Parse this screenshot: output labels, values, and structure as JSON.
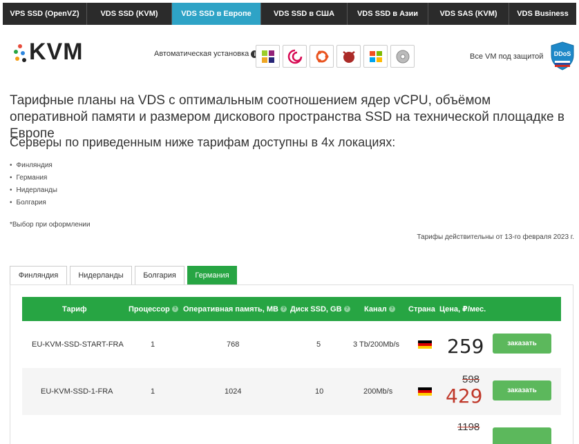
{
  "topnav": {
    "tabs": [
      {
        "label": "VPS SSD (OpenVZ)",
        "active": false
      },
      {
        "label": "VDS SSD (KVM)",
        "active": false
      },
      {
        "label": "VDS SSD в Европе",
        "active": true
      },
      {
        "label": "VDS SSD в США",
        "active": false
      },
      {
        "label": "VDS SSD в Азии",
        "active": false
      },
      {
        "label": "VDS SAS (KVM)",
        "active": false
      },
      {
        "label": "VDS Business",
        "active": false
      }
    ]
  },
  "header": {
    "logo_text": "KVM",
    "auto_install_label": "Автоматическая установка",
    "os_icons": [
      "centos-icon",
      "debian-icon",
      "ubuntu-icon",
      "freebsd-icon",
      "windows-icon",
      "iso-disk-icon"
    ],
    "protection_label": "Все VM под защитой",
    "ddos_badge": "DDoS"
  },
  "content": {
    "headline": "Тарифные планы на VDS с оптимальным соотношением ядер vCPU, объёмом оперативной памяти и размером дискового пространства SSD на технической площадке в Европе",
    "subhead": "Серверы по приведенным ниже тарифам доступны в 4х локациях:",
    "locations": [
      "Финляндия",
      "Германия",
      "Нидерланды",
      "Болгария"
    ],
    "choice_note": "*Выбор при оформлении",
    "valid_note": "Тарифы действительны от 13-го февраля 2023 г."
  },
  "location_tabs": [
    {
      "label": "Финляндия",
      "active": false
    },
    {
      "label": "Нидерланды",
      "active": false
    },
    {
      "label": "Болгария",
      "active": false
    },
    {
      "label": "Германия",
      "active": true
    }
  ],
  "table": {
    "headers": {
      "plan": "Тариф",
      "cpu": "Процессор",
      "ram": "Оперативная память, MB",
      "disk": "Диск SSD, GB",
      "channel": "Канал",
      "country": "Страна",
      "price": "Цена, ₽/мес."
    },
    "rows": [
      {
        "plan": "EU-KVM-SSD-START-FRA",
        "cpu": "1",
        "ram": "768",
        "disk": "5",
        "channel": "3 Tb/200Mb/s",
        "old_price": "",
        "price": "259",
        "order": "заказать"
      },
      {
        "plan": "EU-KVM-SSD-1-FRA",
        "cpu": "1",
        "ram": "1024",
        "disk": "10",
        "channel": "200Mb/s",
        "old_price": "598",
        "price": "429",
        "order": "заказать"
      },
      {
        "plan": "",
        "cpu": "",
        "ram": "",
        "disk": "",
        "channel": "",
        "old_price": "1198",
        "price": "",
        "order": ""
      }
    ]
  },
  "colors": {
    "nav_bg": "#2b2b2b",
    "nav_active": "#2ea3c6",
    "table_header": "#27a543",
    "order_button": "#5cb85c",
    "discount_red": "#c0392b"
  }
}
